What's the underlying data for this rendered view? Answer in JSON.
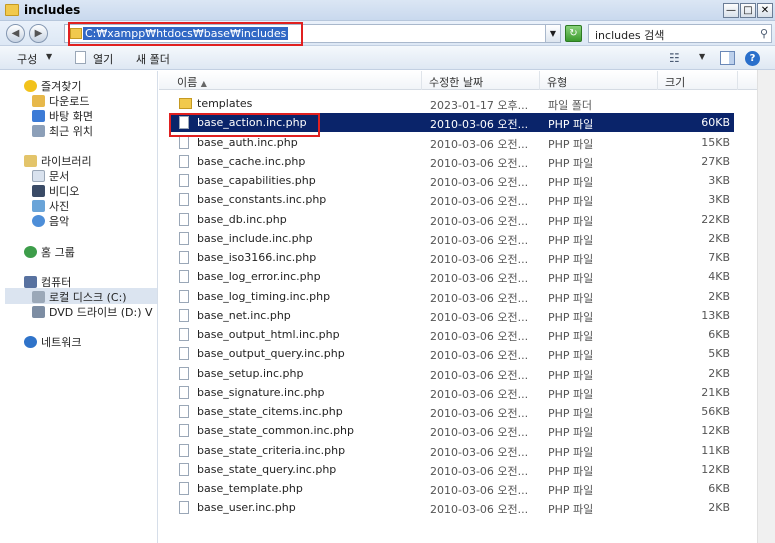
{
  "window": {
    "title": "includes",
    "minimize_label": "—",
    "maximize_label": "□",
    "close_label": "✕"
  },
  "address": {
    "path": "C:₩xampp₩htdocs₩base₩includes",
    "search_placeholder": "includes 검색"
  },
  "toolbar": {
    "organize_label": "구성",
    "open_label": "열기",
    "new_folder_label": "새 폴더"
  },
  "sidebar": {
    "favorites": "즐겨찾기",
    "downloads": "다운로드",
    "desktop": "바탕 화면",
    "recent": "최근 위치",
    "libraries": "라이브러리",
    "documents": "문서",
    "videos": "비디오",
    "pictures": "사진",
    "music": "음악",
    "homegroup": "홈 그룹",
    "computer": "컴퓨터",
    "local_disk": "로컬 디스크 (C:)",
    "dvd_drive": "DVD 드라이브 (D:) V",
    "network": "네트워크"
  },
  "columns": {
    "name": "이름",
    "date": "수정한 날짜",
    "type": "유형",
    "size": "크기"
  },
  "files": [
    {
      "name": "templates",
      "date": "2023-01-17 오후...",
      "type": "파일 폴더",
      "size": "",
      "folder": true
    },
    {
      "name": "base_action.inc.php",
      "date": "2010-03-06 오전...",
      "type": "PHP 파일",
      "size": "60KB",
      "selected": true
    },
    {
      "name": "base_auth.inc.php",
      "date": "2010-03-06 오전...",
      "type": "PHP 파일",
      "size": "15KB"
    },
    {
      "name": "base_cache.inc.php",
      "date": "2010-03-06 오전...",
      "type": "PHP 파일",
      "size": "27KB"
    },
    {
      "name": "base_capabilities.php",
      "date": "2010-03-06 오전...",
      "type": "PHP 파일",
      "size": "3KB"
    },
    {
      "name": "base_constants.inc.php",
      "date": "2010-03-06 오전...",
      "type": "PHP 파일",
      "size": "3KB"
    },
    {
      "name": "base_db.inc.php",
      "date": "2010-03-06 오전...",
      "type": "PHP 파일",
      "size": "22KB"
    },
    {
      "name": "base_include.inc.php",
      "date": "2010-03-06 오전...",
      "type": "PHP 파일",
      "size": "2KB"
    },
    {
      "name": "base_iso3166.inc.php",
      "date": "2010-03-06 오전...",
      "type": "PHP 파일",
      "size": "7KB"
    },
    {
      "name": "base_log_error.inc.php",
      "date": "2010-03-06 오전...",
      "type": "PHP 파일",
      "size": "4KB"
    },
    {
      "name": "base_log_timing.inc.php",
      "date": "2010-03-06 오전...",
      "type": "PHP 파일",
      "size": "2KB"
    },
    {
      "name": "base_net.inc.php",
      "date": "2010-03-06 오전...",
      "type": "PHP 파일",
      "size": "13KB"
    },
    {
      "name": "base_output_html.inc.php",
      "date": "2010-03-06 오전...",
      "type": "PHP 파일",
      "size": "6KB"
    },
    {
      "name": "base_output_query.inc.php",
      "date": "2010-03-06 오전...",
      "type": "PHP 파일",
      "size": "5KB"
    },
    {
      "name": "base_setup.inc.php",
      "date": "2010-03-06 오전...",
      "type": "PHP 파일",
      "size": "2KB"
    },
    {
      "name": "base_signature.inc.php",
      "date": "2010-03-06 오전...",
      "type": "PHP 파일",
      "size": "21KB"
    },
    {
      "name": "base_state_citems.inc.php",
      "date": "2010-03-06 오전...",
      "type": "PHP 파일",
      "size": "56KB"
    },
    {
      "name": "base_state_common.inc.php",
      "date": "2010-03-06 오전...",
      "type": "PHP 파일",
      "size": "12KB"
    },
    {
      "name": "base_state_criteria.inc.php",
      "date": "2010-03-06 오전...",
      "type": "PHP 파일",
      "size": "11KB"
    },
    {
      "name": "base_state_query.inc.php",
      "date": "2010-03-06 오전...",
      "type": "PHP 파일",
      "size": "12KB"
    },
    {
      "name": "base_template.php",
      "date": "2010-03-06 오전...",
      "type": "PHP 파일",
      "size": "6KB"
    },
    {
      "name": "base_user.inc.php",
      "date": "2010-03-06 오전...",
      "type": "PHP 파일",
      "size": "2KB"
    }
  ],
  "colors": {
    "selection": "#0a246a",
    "highlight_box": "#e02020"
  }
}
